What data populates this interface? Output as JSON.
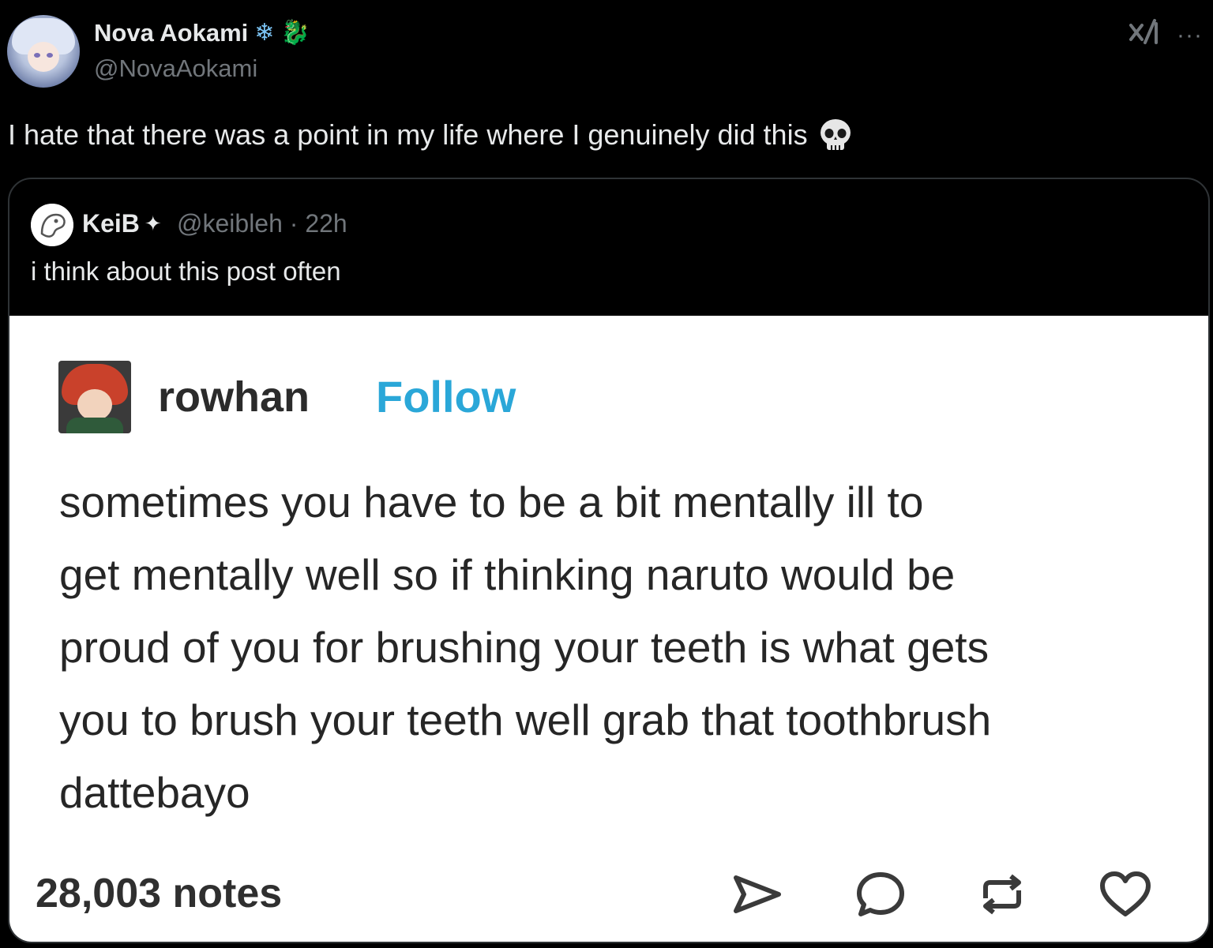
{
  "post": {
    "author_name": "Nova Aokami",
    "author_handle": "@NovaAokami",
    "name_emojis": [
      "❄",
      "🐉"
    ],
    "text": "I hate that there was a point in my life where I genuinely did this",
    "text_emoji": "skull-emoji",
    "more_label": "···"
  },
  "quote": {
    "author_name": "KeiB",
    "badge": "✦",
    "meta": "@keibleh · 22h",
    "text": "i think about this post often",
    "image": {
      "username": "rowhan",
      "follow_label": "Follow",
      "body": "sometimes you have to be a bit mentally ill to\nget mentally well so if thinking naruto would be\nproud of you for brushing your teeth is what gets\nyou to brush your teeth well grab that toothbrush\ndattebayo",
      "notes": "28,003 notes",
      "actions": [
        "share-icon",
        "reply-icon",
        "reblog-icon",
        "like-icon"
      ]
    }
  },
  "colors": {
    "background": "#000000",
    "primary_text": "#e7e9ea",
    "secondary_text": "#71767b",
    "follow_blue": "#2aa7d8"
  }
}
